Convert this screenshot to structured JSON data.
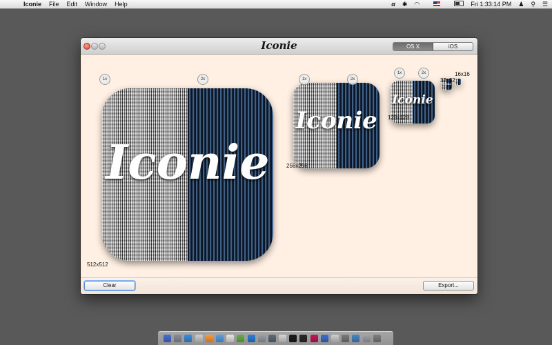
{
  "menubar": {
    "apple_glyph": "",
    "app_name": "Iconie",
    "menus": [
      "File",
      "Edit",
      "Window",
      "Help"
    ],
    "clock": "Fri 1:33:14 PM",
    "icons": [
      "script-menu-icon",
      "bluetooth-icon",
      "wifi-icon",
      "us-flag-icon",
      "battery-icon",
      "user-icon",
      "spotlight-icon",
      "notification-center-icon"
    ]
  },
  "window": {
    "title": "Iconie",
    "segments": [
      "OS X",
      "iOS"
    ],
    "selected_segment": "OS X"
  },
  "previews": {
    "icon_text": "Iconie",
    "badge_1x": "1x",
    "badge_2x": "2x",
    "size_512": "512x512",
    "size_256": "256x256",
    "size_128": "128x128",
    "size_32": "32x32",
    "size_16": "16x16"
  },
  "buttons": {
    "clear": "Clear",
    "export": "Export..."
  },
  "dock": {
    "colors": [
      "#4a6fd1",
      "#8a8f99",
      "#3b8ee0",
      "#d0d0d0",
      "#ff9b3a",
      "#5aa0e8",
      "#e8e8e8",
      "#6bb04a",
      "#2f7fd8",
      "#9aa0a8",
      "#5f6b78",
      "#d8d8d8",
      "#1c1c1c",
      "#2a2a2a",
      "#c2185b",
      "#3c6fd0",
      "#d0d0d0",
      "#7a7a7a",
      "#4b86c8",
      "#9fa6ad",
      "#808080"
    ]
  }
}
